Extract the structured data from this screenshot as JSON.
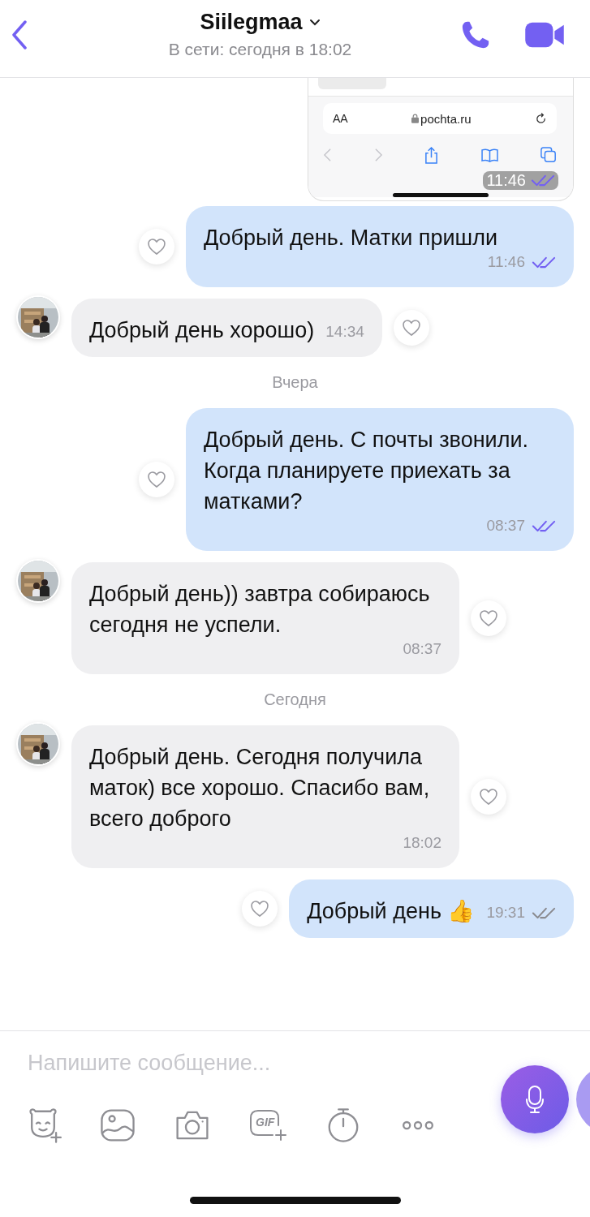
{
  "header": {
    "title": "Siilegmaa",
    "status": "В сети: сегодня в 18:02"
  },
  "messages": [
    {
      "kind": "screenshot",
      "url": "pochta.ru",
      "text_size": "AA",
      "time": "11:46",
      "read": true
    },
    {
      "kind": "outgoing",
      "text": "Добрый день. Матки пришли",
      "time": "11:46",
      "read": true
    },
    {
      "kind": "incoming",
      "text": "Добрый день хорошо)",
      "time": "14:34"
    },
    {
      "kind": "date",
      "text": "Вчера"
    },
    {
      "kind": "outgoing",
      "text": "Добрый день. С почты звонили. Когда планируете приехать за матками?",
      "time": "08:37",
      "read": true
    },
    {
      "kind": "incoming",
      "text": "Добрый день)) завтра собираюсь сегодня не успели.",
      "time": "08:37"
    },
    {
      "kind": "date",
      "text": "Сегодня"
    },
    {
      "kind": "incoming",
      "text": "Добрый день. Сегодня получила маток) все хорошо. Спасибо вам, всего доброго",
      "time": "18:02"
    },
    {
      "kind": "outgoing",
      "text": "Добрый день 👍",
      "time": "19:31",
      "read": false
    }
  ],
  "composer": {
    "placeholder": "Напишите сообщение..."
  },
  "toolbar": [
    {
      "kind": "sticker"
    },
    {
      "kind": "gallery"
    },
    {
      "kind": "camera"
    },
    {
      "kind": "gif",
      "label": "GIF"
    },
    {
      "kind": "timer"
    },
    {
      "kind": "more"
    }
  ]
}
